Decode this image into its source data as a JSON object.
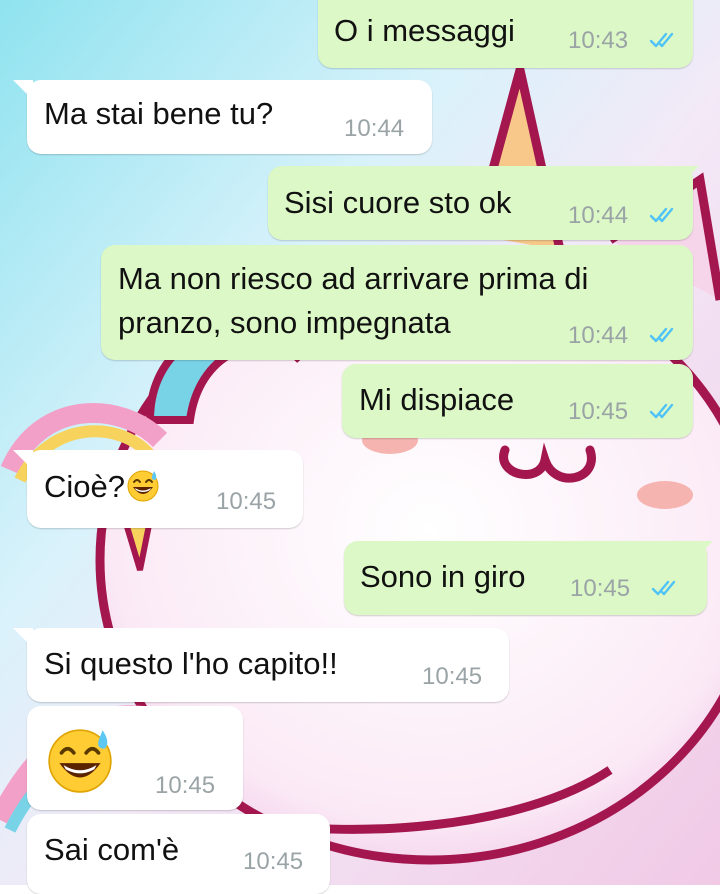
{
  "colors": {
    "outgoing_bubble": "#DCF8C6",
    "incoming_bubble": "#FFFFFF",
    "read_ticks": "#4FC3F7",
    "timestamp": "#9AA3A6"
  },
  "wallpaper": {
    "description": "pastel gradient with unicorn illustration"
  },
  "messages": [
    {
      "direction": "out",
      "lines": [
        "O i messaggi"
      ],
      "time": "10:43",
      "status": "read-ticks-icon"
    },
    {
      "direction": "in",
      "lines": [
        "Ma stai bene tu?"
      ],
      "time": "10:44"
    },
    {
      "direction": "out",
      "lines": [
        "Sisi cuore sto ok"
      ],
      "time": "10:44",
      "status": "read-ticks-icon"
    },
    {
      "direction": "out",
      "lines": [
        "Ma non riesco ad arrivare prima di",
        "pranzo, sono impegnata"
      ],
      "time": "10:44",
      "status": "read-ticks-icon"
    },
    {
      "direction": "out",
      "lines": [
        "Mi dispiace"
      ],
      "time": "10:45",
      "status": "read-ticks-icon"
    },
    {
      "direction": "in",
      "lines": [
        "Cioè?"
      ],
      "emoji": "grinning-sweat-emoji",
      "time": "10:45"
    },
    {
      "direction": "out",
      "lines": [
        "Sono in giro"
      ],
      "time": "10:45",
      "status": "read-ticks-icon"
    },
    {
      "direction": "in",
      "lines": [
        "Si questo l'ho capito!!"
      ],
      "time": "10:45"
    },
    {
      "direction": "in",
      "lines": [],
      "emoji": "grinning-sweat-emoji",
      "time": "10:45"
    },
    {
      "direction": "in",
      "lines": [
        "Sai com'è"
      ],
      "time": "10:45"
    }
  ]
}
